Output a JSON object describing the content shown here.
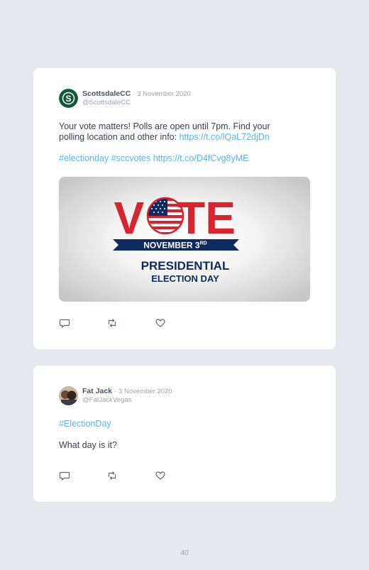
{
  "tweets": [
    {
      "name": "ScottsdaleCC",
      "separator": "·",
      "date": "3 November 2020",
      "handle": "@ScottsdaleCC",
      "text_line1": "Your vote matters! Polls are open until 7pm. Find your",
      "text_line2_prefix": "polling location and other info:",
      "text_link1": "https://t.co/lQaL72djDn",
      "hashtags": "#electionday #sccvotes",
      "text_link2": "https://t.co/D4fCvg8yME",
      "image": {
        "word_v": "V",
        "word_te": "TE",
        "banner": "NOVEMBER 3",
        "banner_sup": "RD",
        "line1": "PRESIDENTIAL",
        "line2": "ELECTION DAY"
      }
    },
    {
      "name": "Fat Jack",
      "separator": "·",
      "date": "3 November 2020",
      "handle": "@FatJackVegas",
      "hashtag": "#ElectionDay",
      "text": "What day is it?"
    }
  ],
  "icons": [
    "reply-icon",
    "retweet-icon",
    "like-icon"
  ],
  "colors": {
    "link": "#5fb3e6",
    "vote_red": "#d9232e",
    "vote_navy": "#0f2a5c",
    "avatar_green": "#0f5a3a"
  },
  "page_number": "40"
}
